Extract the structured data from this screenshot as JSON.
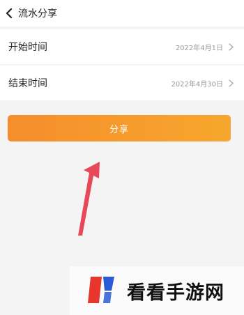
{
  "header": {
    "title": "流水分享",
    "back_icon": "chevron-left-icon"
  },
  "rows": [
    {
      "label": "开始时间",
      "value": "2022年4月1日",
      "icon": "chevron-right-icon"
    },
    {
      "label": "结束时间",
      "value": "2022年4月30日",
      "icon": "chevron-right-icon"
    }
  ],
  "share_button": {
    "label": "分享",
    "gradient_start": "#f58d2c",
    "gradient_end": "#f7a72d"
  },
  "annotation": {
    "arrow_color": "#e8495a"
  },
  "watermark": {
    "text": "看看手游网",
    "logo_colors": [
      "#e8362f",
      "#2a5bd7"
    ]
  }
}
